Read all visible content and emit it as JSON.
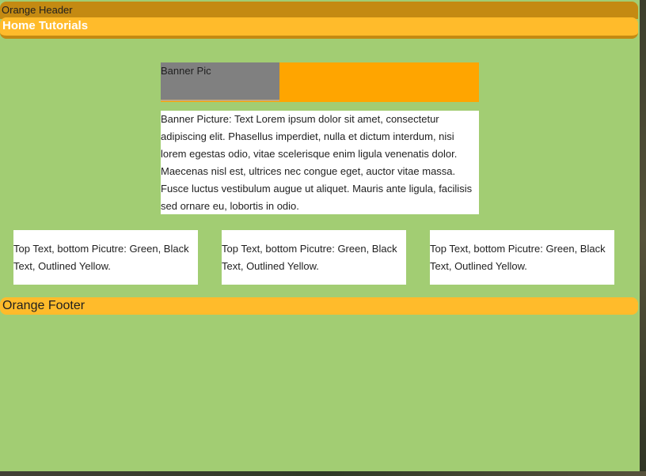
{
  "header": {
    "top_label": "Orange Header",
    "nav_link": "Home Tutorials"
  },
  "banner": {
    "pic_label": "Banner Pic",
    "text": "Banner Picture: Text Lorem ipsum dolor sit amet, consectetur adipiscing elit. Phasellus imperdiet, nulla et dictum interdum, nisi lorem egestas odio, vitae scelerisque enim ligula venenatis dolor. Maecenas nisl est, ultrices nec congue eget, auctor vitae massa. Fusce luctus vestibulum augue ut aliquet. Mauris ante ligula, facilisis sed ornare eu, lobortis in odio."
  },
  "cards": [
    {
      "text": "Top Text, bottom Picutre: Green, Black Text, Outlined Yellow."
    },
    {
      "text": "Top Text, bottom Picutre: Green, Black Text, Outlined Yellow."
    },
    {
      "text": "Top Text, bottom Picutre: Green, Black Text, Outlined Yellow."
    }
  ],
  "footer": {
    "label": "Orange Footer"
  },
  "colors": {
    "page_background": "#a2cd73",
    "header_dark": "#c48a12",
    "header_light": "#ffbb2b",
    "banner_orange": "#ffa500",
    "banner_pic_gray": "#808080"
  }
}
